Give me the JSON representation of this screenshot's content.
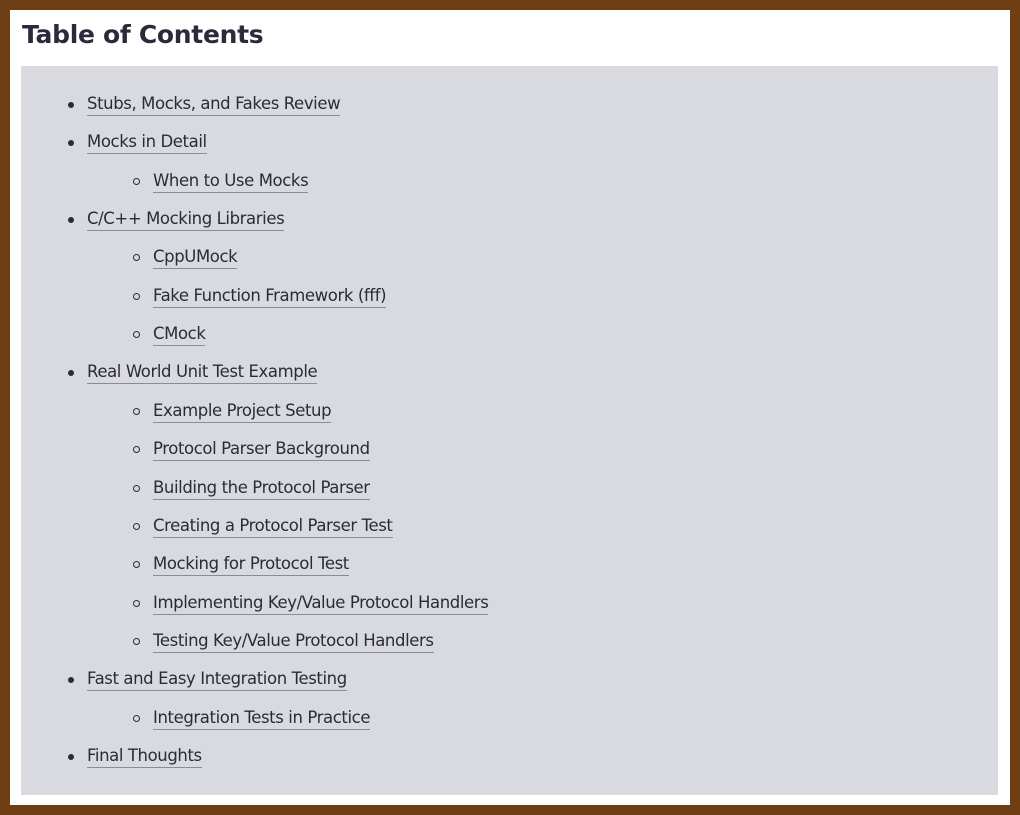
{
  "title": "Table of Contents",
  "items": [
    {
      "label": "Stubs, Mocks, and Fakes Review",
      "level": 1
    },
    {
      "label": "Mocks in Detail",
      "level": 1
    },
    {
      "label": "When to Use Mocks",
      "level": 2
    },
    {
      "label": "C/C++ Mocking Libraries",
      "level": 1
    },
    {
      "label": "CppUMock",
      "level": 2
    },
    {
      "label": "Fake Function Framework (fff)",
      "level": 2
    },
    {
      "label": "CMock",
      "level": 2
    },
    {
      "label": "Real World Unit Test Example",
      "level": 1
    },
    {
      "label": "Example Project Setup",
      "level": 2
    },
    {
      "label": "Protocol Parser Background",
      "level": 2
    },
    {
      "label": "Building the Protocol Parser",
      "level": 2
    },
    {
      "label": "Creating a Protocol Parser Test",
      "level": 2
    },
    {
      "label": "Mocking for Protocol Test",
      "level": 2
    },
    {
      "label": "Implementing Key/Value Protocol Handlers",
      "level": 2
    },
    {
      "label": "Testing Key/Value Protocol Handlers",
      "level": 2
    },
    {
      "label": "Fast and Easy Integration Testing",
      "level": 1
    },
    {
      "label": "Integration Tests in Practice",
      "level": 2
    },
    {
      "label": "Final Thoughts",
      "level": 1
    }
  ],
  "colors": {
    "frame_border": "#6e3f14",
    "panel_background": "#d9dae0",
    "text": "#2b2a3a",
    "link_underline": "#8a8b97"
  }
}
